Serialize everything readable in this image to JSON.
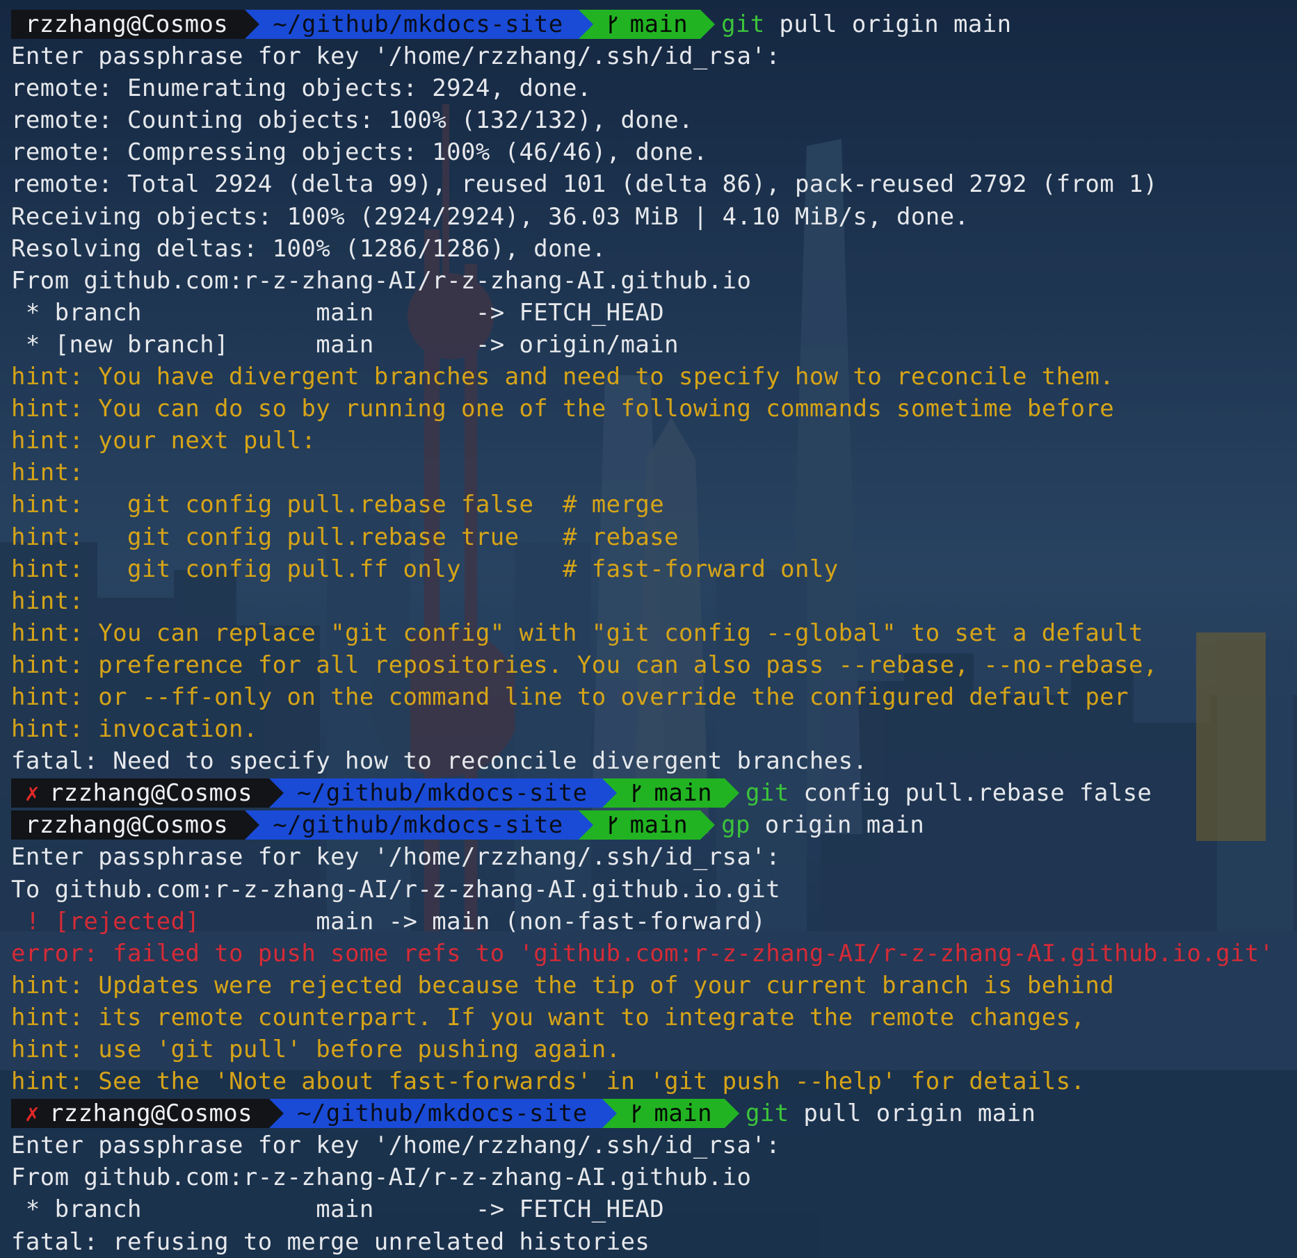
{
  "prompt": {
    "user_host": "rzzhang@Cosmos",
    "path": "~/github/mkdocs-site",
    "branch": "main",
    "error_mark": "✗"
  },
  "commands": {
    "c1": {
      "verb": "git",
      "args": " pull origin main"
    },
    "c2": {
      "verb": "git",
      "args": " config pull.rebase false"
    },
    "c3": {
      "verb": "gp",
      "args": " origin main"
    },
    "c4": {
      "verb": "git",
      "args": " pull origin main"
    }
  },
  "output": {
    "block1": [
      {
        "text": "Enter passphrase for key '/home/rzzhang/.ssh/id_rsa':",
        "color": "white"
      },
      {
        "text": "remote: Enumerating objects: 2924, done.",
        "color": "white"
      },
      {
        "text": "remote: Counting objects: 100% (132/132), done.",
        "color": "white"
      },
      {
        "text": "remote: Compressing objects: 100% (46/46), done.",
        "color": "white"
      },
      {
        "text": "remote: Total 2924 (delta 99), reused 101 (delta 86), pack-reused 2792 (from 1)",
        "color": "white"
      },
      {
        "text": "Receiving objects: 100% (2924/2924), 36.03 MiB | 4.10 MiB/s, done.",
        "color": "white"
      },
      {
        "text": "Resolving deltas: 100% (1286/1286), done.",
        "color": "white"
      },
      {
        "text": "From github.com:r-z-zhang-AI/r-z-zhang-AI.github.io",
        "color": "white"
      },
      {
        "text": " * branch            main       -> FETCH_HEAD",
        "color": "white"
      },
      {
        "text": " * [new branch]      main       -> origin/main",
        "color": "white"
      },
      {
        "text": "hint: You have divergent branches and need to specify how to reconcile them.",
        "color": "yellow"
      },
      {
        "text": "hint: You can do so by running one of the following commands sometime before",
        "color": "yellow"
      },
      {
        "text": "hint: your next pull:",
        "color": "yellow"
      },
      {
        "text": "hint:",
        "color": "yellow"
      },
      {
        "text": "hint:   git config pull.rebase false  # merge",
        "color": "yellow"
      },
      {
        "text": "hint:   git config pull.rebase true   # rebase",
        "color": "yellow"
      },
      {
        "text": "hint:   git config pull.ff only       # fast-forward only",
        "color": "yellow"
      },
      {
        "text": "hint:",
        "color": "yellow"
      },
      {
        "text": "hint: You can replace \"git config\" with \"git config --global\" to set a default",
        "color": "yellow"
      },
      {
        "text": "hint: preference for all repositories. You can also pass --rebase, --no-rebase,",
        "color": "yellow"
      },
      {
        "text": "hint: or --ff-only on the command line to override the configured default per",
        "color": "yellow"
      },
      {
        "text": "hint: invocation.",
        "color": "yellow"
      },
      {
        "text": "fatal: Need to specify how to reconcile divergent branches.",
        "color": "white"
      }
    ],
    "block3": [
      {
        "text": "Enter passphrase for key '/home/rzzhang/.ssh/id_rsa':",
        "color": "white"
      },
      {
        "text": "To github.com:r-z-zhang-AI/r-z-zhang-AI.github.io.git",
        "color": "white"
      }
    ],
    "rejected": {
      "mark": " ! [rejected]",
      "rest": "        main -> main (non-fast-forward)"
    },
    "block3b": [
      {
        "text": "error: failed to push some refs to 'github.com:r-z-zhang-AI/r-z-zhang-AI.github.io.git'",
        "color": "red"
      },
      {
        "text": "hint: Updates were rejected because the tip of your current branch is behind",
        "color": "yellow"
      },
      {
        "text": "hint: its remote counterpart. If you want to integrate the remote changes,",
        "color": "yellow"
      },
      {
        "text": "hint: use 'git pull' before pushing again.",
        "color": "yellow"
      },
      {
        "text": "hint: See the 'Note about fast-forwards' in 'git push --help' for details.",
        "color": "yellow"
      }
    ],
    "block4": [
      {
        "text": "Enter passphrase for key '/home/rzzhang/.ssh/id_rsa':",
        "color": "white"
      },
      {
        "text": "From github.com:r-z-zhang-AI/r-z-zhang-AI.github.io",
        "color": "white"
      },
      {
        "text": " * branch            main       -> FETCH_HEAD",
        "color": "white"
      },
      {
        "text": "fatal: refusing to merge unrelated histories",
        "color": "white"
      }
    ]
  },
  "theme": {
    "hint_color": "#d6a418",
    "error_color": "#d42b36",
    "command_color": "#3cc43a",
    "user_segment": "#121418",
    "path_segment": "#1a4bd6",
    "branch_segment": "#22b323"
  }
}
